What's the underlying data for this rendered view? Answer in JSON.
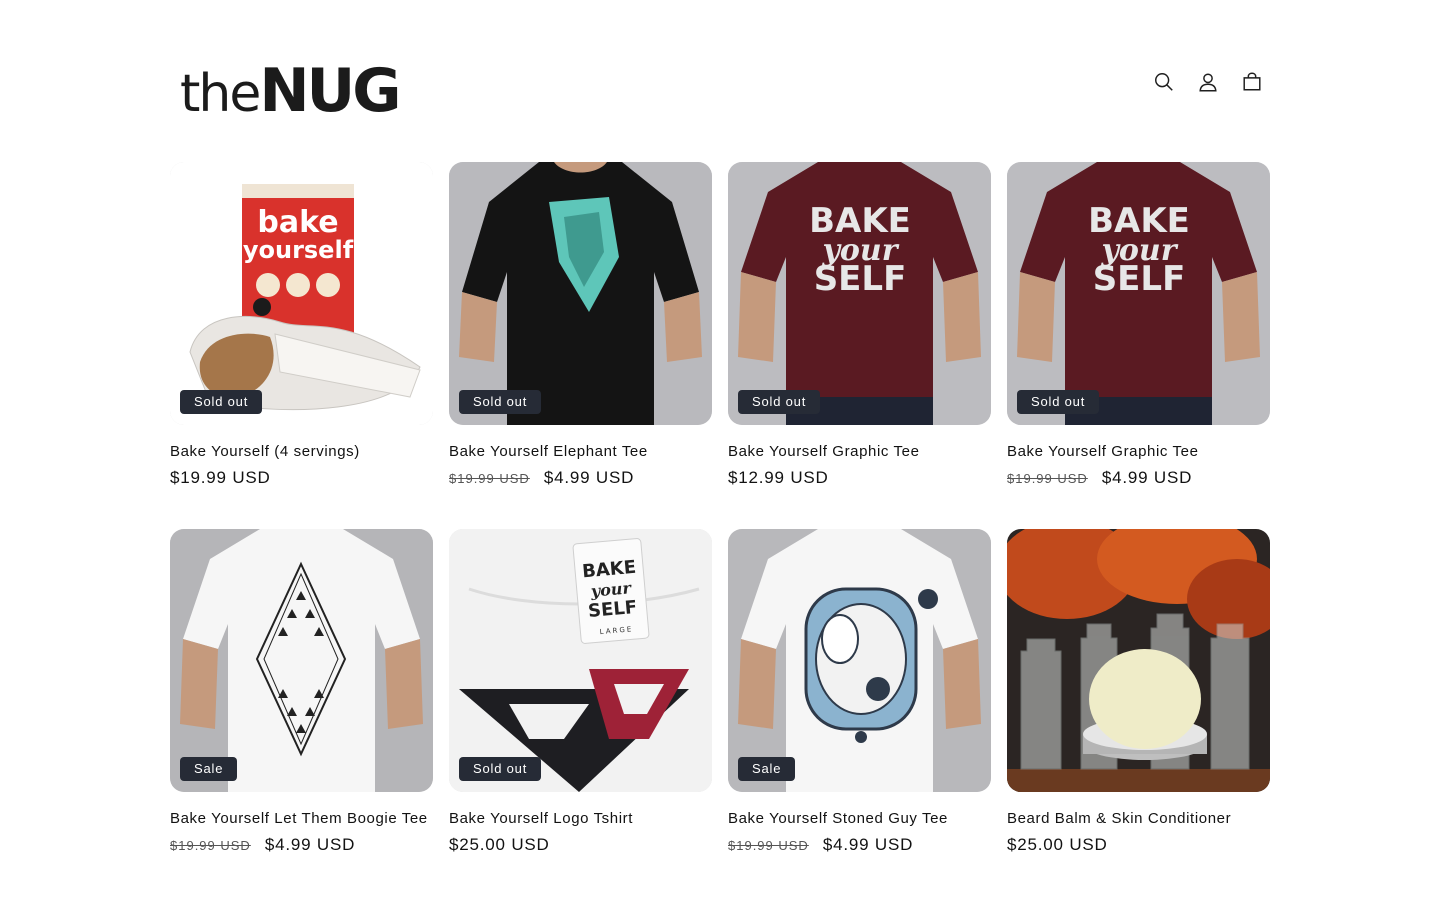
{
  "brand": {
    "prefix": "the",
    "name": "NUG"
  },
  "header": {
    "icons": [
      "search-icon",
      "account-icon",
      "cart-icon"
    ]
  },
  "products": [
    {
      "title": "Bake Yourself (4 servings)",
      "compare_price": "",
      "price": "$19.99 USD",
      "badge": "Sold out",
      "image": "brownie-box"
    },
    {
      "title": "Bake Yourself Elephant Tee",
      "compare_price": "$19.99 USD",
      "price": "$4.99 USD",
      "badge": "Sold out",
      "image": "black-tee-elephant"
    },
    {
      "title": "Bake Yourself Graphic Tee",
      "compare_price": "",
      "price": "$12.99 USD",
      "badge": "Sold out",
      "image": "maroon-tee-bake-yourself"
    },
    {
      "title": "Bake Yourself Graphic Tee",
      "compare_price": "$19.99 USD",
      "price": "$4.99 USD",
      "badge": "Sold out",
      "image": "maroon-tee-bake-yourself"
    },
    {
      "title": "Bake Yourself Let Them Boogie Tee",
      "compare_price": "$19.99 USD",
      "price": "$4.99 USD",
      "badge": "Sale",
      "image": "white-tee-diamond"
    },
    {
      "title": "Bake Yourself Logo Tshirt",
      "compare_price": "",
      "price": "$25.00 USD",
      "badge": "Sold out",
      "image": "white-tee-logo-tag"
    },
    {
      "title": "Bake Yourself Stoned Guy Tee",
      "compare_price": "$19.99 USD",
      "price": "$4.99 USD",
      "badge": "Sale",
      "image": "white-tee-stoned-guy"
    },
    {
      "title": "Beard Balm & Skin Conditioner",
      "compare_price": "",
      "price": "$25.00 USD",
      "badge": "",
      "image": "beard-balm-tin"
    }
  ],
  "image_text": {
    "box_brand_line1": "bake",
    "box_brand_line2": "yourself",
    "tee_line1": "BAKE",
    "tee_line2": "your",
    "tee_line3": "SELF",
    "tag_line1": "BAKE",
    "tag_line2": "your",
    "tag_line3": "SELF",
    "tag_size": "LARGE"
  },
  "colors": {
    "badge_bg": "#262b36",
    "text": "#121212",
    "maroon": "#5a1a22",
    "teal": "#5ec6b9",
    "crimson": "#9e2237"
  }
}
